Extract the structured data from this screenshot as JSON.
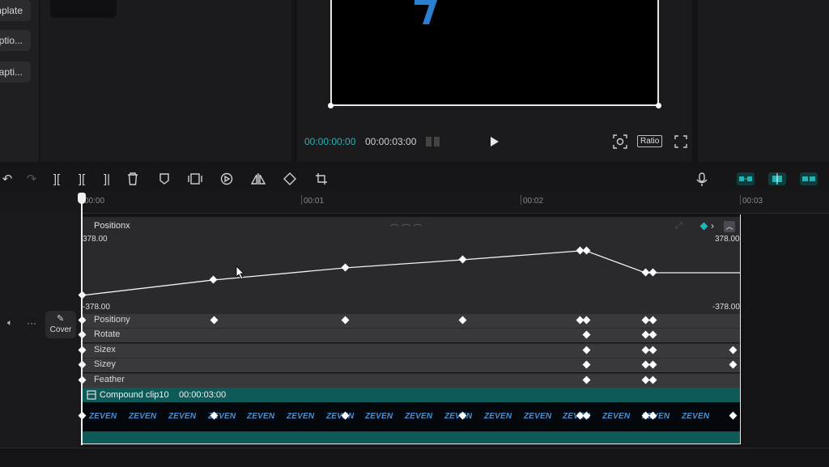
{
  "left_buttons": [
    "nplate",
    "ptio...",
    "apti..."
  ],
  "player": {
    "current_time": "00:00:00:00",
    "total_time": "00:00:03:00",
    "ratio_label": "Ratio"
  },
  "ruler": {
    "ticks": [
      "00:00",
      "00:01",
      "00:02",
      "00:03"
    ]
  },
  "track": {
    "cover_label": "Cover"
  },
  "graph": {
    "title": "Positionx",
    "max_left": "378.00",
    "max_right": "378.00",
    "min_left": "-378.00",
    "min_right": "-378.00"
  },
  "properties": [
    {
      "label": "Positiony"
    },
    {
      "label": "Rotate"
    },
    {
      "label": "Sizex"
    },
    {
      "label": "Sizey"
    },
    {
      "label": "Feather"
    }
  ],
  "clip": {
    "name": "Compound clip10",
    "duration": "00:00:03:00",
    "thumb_text": [
      "ZEVEN",
      "ZEVEN",
      "ZEVEN",
      "ZEVEN",
      "ZEVEN",
      "ZEVEN",
      "ZEVEN",
      "ZEVEN",
      "ZEVEN",
      "ZEVEN",
      "ZEVEN",
      "ZEVEN",
      "ZEVEN",
      "ZEVEN",
      "ZEVEN",
      "ZEVEN"
    ]
  },
  "colors": {
    "accent": "#1fb5b5",
    "clip_teal": "#0e5a58",
    "keyframe": "#ffffff"
  }
}
